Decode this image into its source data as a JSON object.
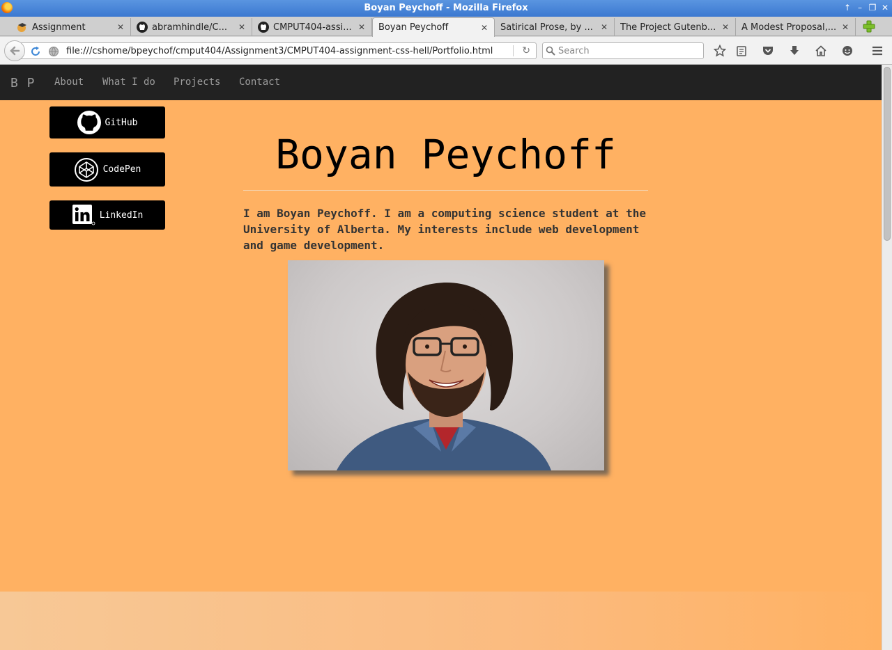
{
  "window": {
    "title": "Boyan Peychoff - Mozilla Firefox"
  },
  "tabs": [
    {
      "label": "Assignment",
      "icon": "eclass-icon",
      "active": false
    },
    {
      "label": "abramhindle/C...",
      "icon": "github-icon",
      "active": false
    },
    {
      "label": "CMPUT404-assi...",
      "icon": "github-icon",
      "active": false
    },
    {
      "label": "Boyan Peychoff",
      "icon": "none",
      "active": true
    },
    {
      "label": "Satirical Prose, by ...",
      "icon": "none",
      "active": false
    },
    {
      "label": "The Project Gutenb...",
      "icon": "none",
      "active": false
    },
    {
      "label": "A Modest Proposal,...",
      "icon": "none",
      "active": false
    }
  ],
  "toolbar": {
    "url": "file:///cshome/bpeychof/cmput404/Assignment3/CMPUT404-assignment-css-hell/Portfolio.html",
    "search_placeholder": "Search"
  },
  "page": {
    "brand": "B P",
    "nav": [
      "About",
      "What I do",
      "Projects",
      "Contact"
    ],
    "social": [
      {
        "label": "GitHub",
        "icon": "github-icon"
      },
      {
        "label": "CodePen",
        "icon": "codepen-icon"
      },
      {
        "label": "LinkedIn",
        "icon": "linkedin-icon"
      }
    ],
    "heading": "Boyan Peychoff",
    "intro": "I am Boyan Peychoff. I am a computing science student at the University of Alberta. My interests include web development and game development.",
    "colors": {
      "background": "#ffb162",
      "navbar": "#222222",
      "nav_text": "#9d9d9d",
      "button": "#000000"
    }
  }
}
